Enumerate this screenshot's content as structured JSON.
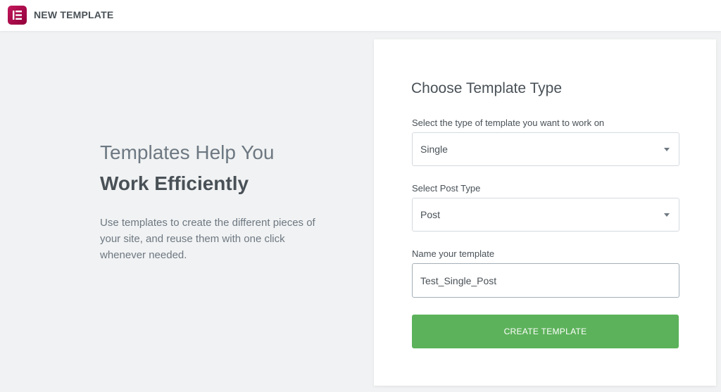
{
  "header": {
    "title": "NEW TEMPLATE",
    "logo_icon": "elementor-logo-icon",
    "logo_color": "#b0144f"
  },
  "intro": {
    "title_line1": "Templates Help You",
    "title_line2": "Work Efficiently",
    "description": "Use templates to create the different pieces of your site, and reuse them with one click whenever needed."
  },
  "form": {
    "title": "Choose Template Type",
    "template_type": {
      "label": "Select the type of template you want to work on",
      "value": "Single"
    },
    "post_type": {
      "label": "Select Post Type",
      "value": "Post"
    },
    "template_name": {
      "label": "Name your template",
      "value": "Test_Single_Post"
    },
    "submit_label": "CREATE TEMPLATE",
    "accent_color": "#5cb25a"
  }
}
